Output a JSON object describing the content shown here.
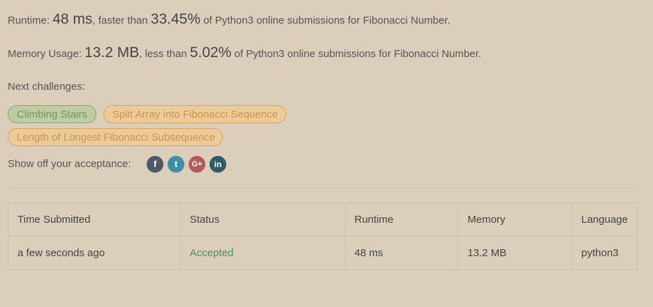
{
  "runtime": {
    "label": "Runtime:",
    "value": "48 ms",
    "mid": ", faster than",
    "percent": "33.45%",
    "suffix": "of Python3 online submissions for Fibonacci Number."
  },
  "memory": {
    "label": "Memory Usage:",
    "value": "13.2 MB",
    "mid": ", less than",
    "percent": "5.02%",
    "suffix": "of Python3 online submissions for Fibonacci Number."
  },
  "next": {
    "title": "Next challenges:",
    "challenges": [
      {
        "label": "Climbing Stairs",
        "difficulty": "easy"
      },
      {
        "label": "Split Array into Fibonacci Sequence",
        "difficulty": "medium"
      },
      {
        "label": "Length of Longest Fibonacci Subsequence",
        "difficulty": "medium"
      }
    ]
  },
  "share": {
    "label": "Show off your acceptance:",
    "icons": [
      "facebook-icon",
      "twitter-icon",
      "google-plus-icon",
      "linkedin-icon"
    ],
    "glyphs": {
      "facebook": "f",
      "twitter": "t",
      "google_plus": "G+",
      "linkedin": "in"
    }
  },
  "table": {
    "headers": [
      "Time Submitted",
      "Status",
      "Runtime",
      "Memory",
      "Language"
    ],
    "rows": [
      [
        "a few seconds ago",
        "Accepted",
        "48 ms",
        "13.2 MB",
        "python3"
      ]
    ]
  },
  "colors": {
    "background": "#dbcfbc",
    "accepted": "#4a8b61",
    "easy_tag": "#6c9a62",
    "medium_tag": "#d0914d"
  }
}
